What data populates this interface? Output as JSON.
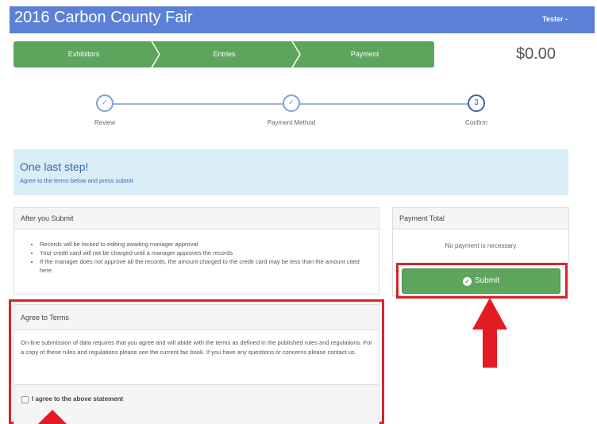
{
  "header": {
    "title": "2016 Carbon County Fair",
    "user_menu": "Tester -"
  },
  "nav": {
    "steps": [
      "Exhibitors",
      "Entries",
      "Payment"
    ],
    "amount": "$0.00"
  },
  "wizard": {
    "steps": [
      {
        "label": "Review",
        "state": "done",
        "icon": "check-icon"
      },
      {
        "label": "Payment Method",
        "state": "done",
        "icon": "check-icon"
      },
      {
        "label": "Confirm",
        "state": "current",
        "number": "3"
      }
    ]
  },
  "alert": {
    "heading": "One last step!",
    "text": "Agree to the terms below and press submit"
  },
  "after_submit": {
    "heading": "After you Submit",
    "items": [
      "Records will be locked to editing awaiting manager approval",
      "Your credit card will not be charged until a manager approves the records",
      "If the manager does not approve all the records, the amount charged to the credit card may be less than the amount cited here."
    ]
  },
  "payment_total": {
    "heading": "Payment Total",
    "message": "No payment is necessary",
    "submit_label": "Submit"
  },
  "terms": {
    "heading": "Agree to Terms",
    "body": "On-line submission of data requires that you agree and will abide with the terms as defined in the published rules and regulations. For a copy of these rules and regulations please see the current fair book. If you have any questions or concerns please contact us.",
    "checkbox_label": "I agree to the above statement",
    "checked": false
  },
  "colors": {
    "topbar": "#5b80d6",
    "nav_green": "#5da55d",
    "highlight_red": "#d8232a",
    "alert_bg": "#d9edf7"
  }
}
